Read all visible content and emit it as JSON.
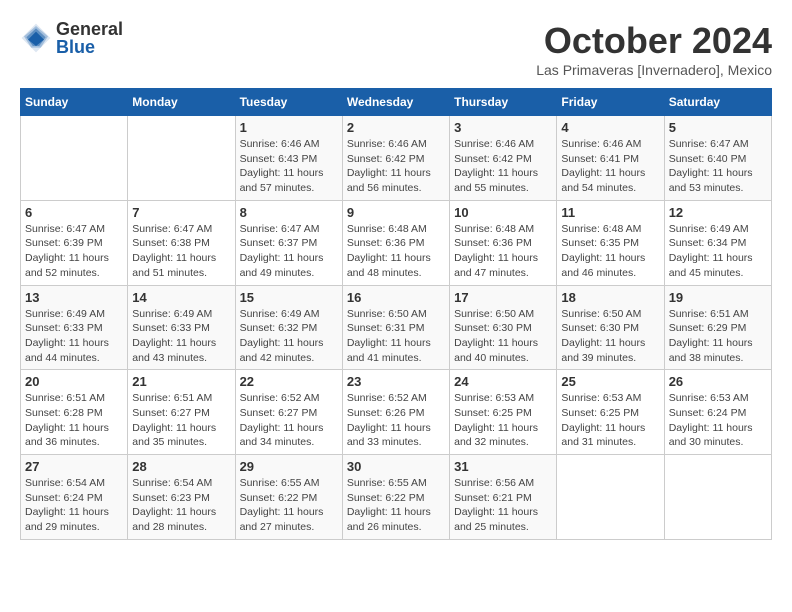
{
  "logo": {
    "general": "General",
    "blue": "Blue"
  },
  "title": {
    "month": "October 2024",
    "location": "Las Primaveras [Invernadero], Mexico"
  },
  "days_of_week": [
    "Sunday",
    "Monday",
    "Tuesday",
    "Wednesday",
    "Thursday",
    "Friday",
    "Saturday"
  ],
  "weeks": [
    [
      {
        "day": "",
        "info": ""
      },
      {
        "day": "",
        "info": ""
      },
      {
        "day": "1",
        "info": "Sunrise: 6:46 AM\nSunset: 6:43 PM\nDaylight: 11 hours and 57 minutes."
      },
      {
        "day": "2",
        "info": "Sunrise: 6:46 AM\nSunset: 6:42 PM\nDaylight: 11 hours and 56 minutes."
      },
      {
        "day": "3",
        "info": "Sunrise: 6:46 AM\nSunset: 6:42 PM\nDaylight: 11 hours and 55 minutes."
      },
      {
        "day": "4",
        "info": "Sunrise: 6:46 AM\nSunset: 6:41 PM\nDaylight: 11 hours and 54 minutes."
      },
      {
        "day": "5",
        "info": "Sunrise: 6:47 AM\nSunset: 6:40 PM\nDaylight: 11 hours and 53 minutes."
      }
    ],
    [
      {
        "day": "6",
        "info": "Sunrise: 6:47 AM\nSunset: 6:39 PM\nDaylight: 11 hours and 52 minutes."
      },
      {
        "day": "7",
        "info": "Sunrise: 6:47 AM\nSunset: 6:38 PM\nDaylight: 11 hours and 51 minutes."
      },
      {
        "day": "8",
        "info": "Sunrise: 6:47 AM\nSunset: 6:37 PM\nDaylight: 11 hours and 49 minutes."
      },
      {
        "day": "9",
        "info": "Sunrise: 6:48 AM\nSunset: 6:36 PM\nDaylight: 11 hours and 48 minutes."
      },
      {
        "day": "10",
        "info": "Sunrise: 6:48 AM\nSunset: 6:36 PM\nDaylight: 11 hours and 47 minutes."
      },
      {
        "day": "11",
        "info": "Sunrise: 6:48 AM\nSunset: 6:35 PM\nDaylight: 11 hours and 46 minutes."
      },
      {
        "day": "12",
        "info": "Sunrise: 6:49 AM\nSunset: 6:34 PM\nDaylight: 11 hours and 45 minutes."
      }
    ],
    [
      {
        "day": "13",
        "info": "Sunrise: 6:49 AM\nSunset: 6:33 PM\nDaylight: 11 hours and 44 minutes."
      },
      {
        "day": "14",
        "info": "Sunrise: 6:49 AM\nSunset: 6:33 PM\nDaylight: 11 hours and 43 minutes."
      },
      {
        "day": "15",
        "info": "Sunrise: 6:49 AM\nSunset: 6:32 PM\nDaylight: 11 hours and 42 minutes."
      },
      {
        "day": "16",
        "info": "Sunrise: 6:50 AM\nSunset: 6:31 PM\nDaylight: 11 hours and 41 minutes."
      },
      {
        "day": "17",
        "info": "Sunrise: 6:50 AM\nSunset: 6:30 PM\nDaylight: 11 hours and 40 minutes."
      },
      {
        "day": "18",
        "info": "Sunrise: 6:50 AM\nSunset: 6:30 PM\nDaylight: 11 hours and 39 minutes."
      },
      {
        "day": "19",
        "info": "Sunrise: 6:51 AM\nSunset: 6:29 PM\nDaylight: 11 hours and 38 minutes."
      }
    ],
    [
      {
        "day": "20",
        "info": "Sunrise: 6:51 AM\nSunset: 6:28 PM\nDaylight: 11 hours and 36 minutes."
      },
      {
        "day": "21",
        "info": "Sunrise: 6:51 AM\nSunset: 6:27 PM\nDaylight: 11 hours and 35 minutes."
      },
      {
        "day": "22",
        "info": "Sunrise: 6:52 AM\nSunset: 6:27 PM\nDaylight: 11 hours and 34 minutes."
      },
      {
        "day": "23",
        "info": "Sunrise: 6:52 AM\nSunset: 6:26 PM\nDaylight: 11 hours and 33 minutes."
      },
      {
        "day": "24",
        "info": "Sunrise: 6:53 AM\nSunset: 6:25 PM\nDaylight: 11 hours and 32 minutes."
      },
      {
        "day": "25",
        "info": "Sunrise: 6:53 AM\nSunset: 6:25 PM\nDaylight: 11 hours and 31 minutes."
      },
      {
        "day": "26",
        "info": "Sunrise: 6:53 AM\nSunset: 6:24 PM\nDaylight: 11 hours and 30 minutes."
      }
    ],
    [
      {
        "day": "27",
        "info": "Sunrise: 6:54 AM\nSunset: 6:24 PM\nDaylight: 11 hours and 29 minutes."
      },
      {
        "day": "28",
        "info": "Sunrise: 6:54 AM\nSunset: 6:23 PM\nDaylight: 11 hours and 28 minutes."
      },
      {
        "day": "29",
        "info": "Sunrise: 6:55 AM\nSunset: 6:22 PM\nDaylight: 11 hours and 27 minutes."
      },
      {
        "day": "30",
        "info": "Sunrise: 6:55 AM\nSunset: 6:22 PM\nDaylight: 11 hours and 26 minutes."
      },
      {
        "day": "31",
        "info": "Sunrise: 6:56 AM\nSunset: 6:21 PM\nDaylight: 11 hours and 25 minutes."
      },
      {
        "day": "",
        "info": ""
      },
      {
        "day": "",
        "info": ""
      }
    ]
  ]
}
